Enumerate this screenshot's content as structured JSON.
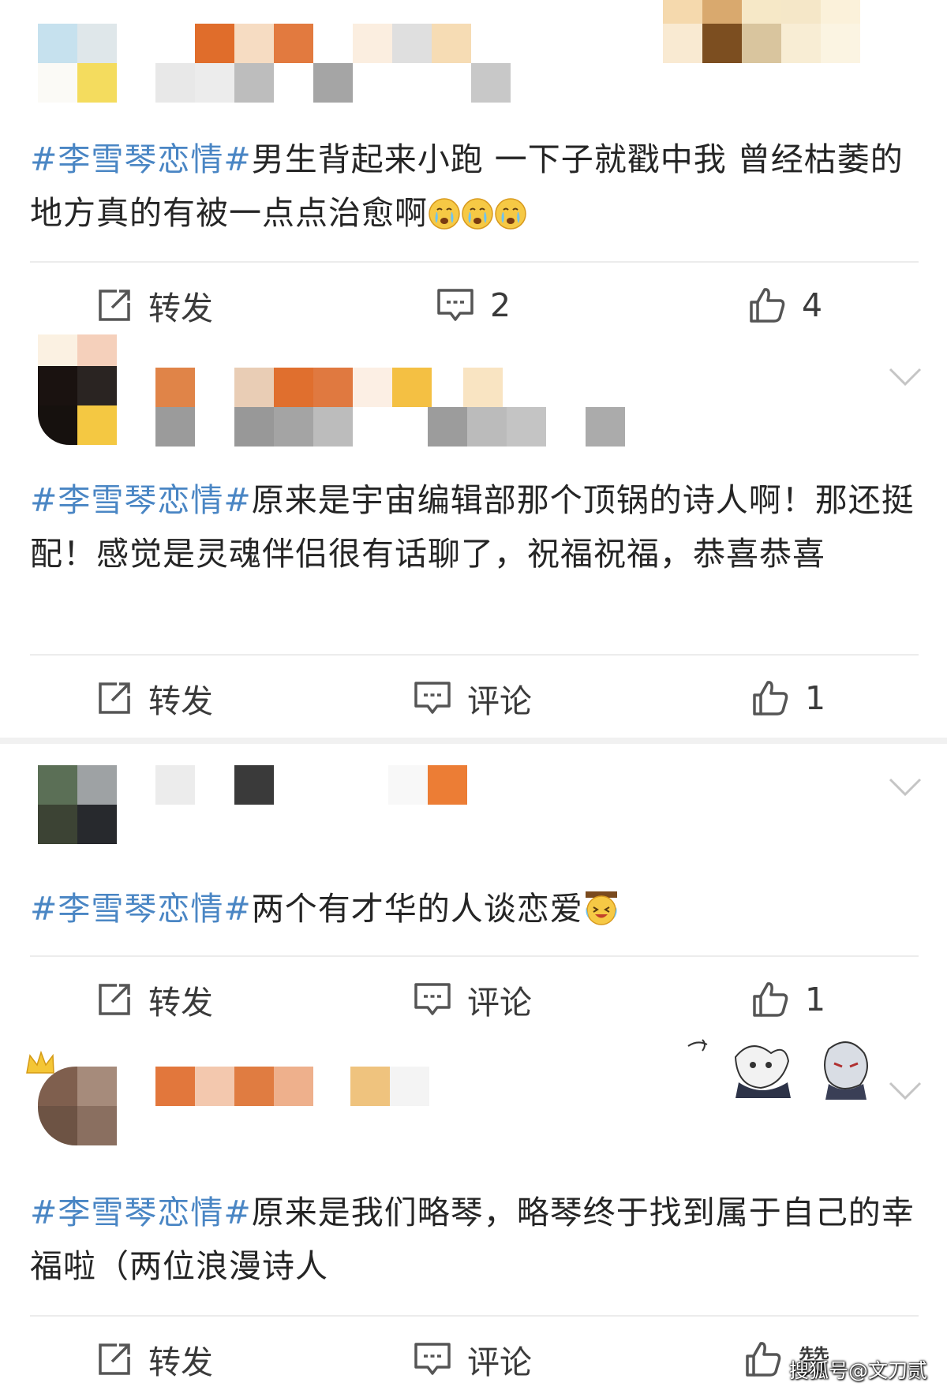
{
  "posts": [
    {
      "text_rest": "男生背起来小跑 一下子就戳中我 曾经枯萎的地方真的有被一点点治愈啊",
      "emojis": [
        "crying-emoji",
        "crying-emoji",
        "crying-emoji"
      ],
      "actions": {
        "repost": "转发",
        "comment": "2",
        "like": "4"
      }
    },
    {
      "text_rest": "原来是宇宙编辑部那个顶锅的诗人啊！那还挺配！感觉是灵魂伴侣很有话聊了，祝福祝福，恭喜恭喜",
      "actions": {
        "repost": "转发",
        "comment": "评论",
        "like": "1"
      }
    },
    {
      "text_rest": "两个有才华的人谈恋爱",
      "emojis": [
        "joy-tears-emoji"
      ],
      "actions": {
        "repost": "转发",
        "comment": "评论",
        "like": "1"
      }
    },
    {
      "text_rest": "原来是我们略琴，略琴终于找到属于自己的幸福啦（两位浪漫诗人",
      "actions": {
        "repost": "转发",
        "comment": "评论",
        "like": "赞"
      }
    }
  ],
  "hashtag": "#李雪琴恋情#",
  "watermark": "搜狐号@文刀贰",
  "colors": {
    "hashtag": "#4a86c4",
    "text": "#252525",
    "icon": "#555555"
  }
}
